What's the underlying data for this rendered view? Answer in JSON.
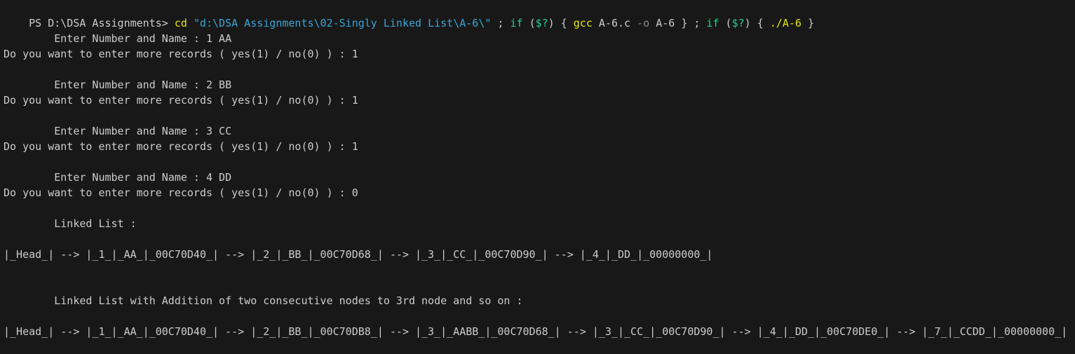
{
  "terminal": {
    "command_line": [
      {
        "text": "PS D:\\DSA Assignments> ",
        "color": "default"
      },
      {
        "text": "cd",
        "color": "yellow"
      },
      {
        "text": " ",
        "color": "default"
      },
      {
        "text": "\"d:\\DSA Assignments\\02-Singly Linked List\\A-6\\\"",
        "color": "cyan"
      },
      {
        "text": " ; ",
        "color": "default"
      },
      {
        "text": "if",
        "color": "green"
      },
      {
        "text": " (",
        "color": "default"
      },
      {
        "text": "$?",
        "color": "green"
      },
      {
        "text": ") { ",
        "color": "default"
      },
      {
        "text": "gcc",
        "color": "yellow"
      },
      {
        "text": " A-6.c ",
        "color": "default"
      },
      {
        "text": "-o",
        "color": "gray"
      },
      {
        "text": " A-6 } ; ",
        "color": "default"
      },
      {
        "text": "if",
        "color": "green"
      },
      {
        "text": " (",
        "color": "default"
      },
      {
        "text": "$?",
        "color": "green"
      },
      {
        "text": ") { ",
        "color": "default"
      },
      {
        "text": "./A-6",
        "color": "yellow"
      },
      {
        "text": " }",
        "color": "default"
      }
    ],
    "output_lines": [
      "",
      "        Enter Number and Name : 1 AA",
      "Do you want to enter more records ( yes(1) / no(0) ) : 1",
      "",
      "        Enter Number and Name : 2 BB",
      "Do you want to enter more records ( yes(1) / no(0) ) : 1",
      "",
      "        Enter Number and Name : 3 CC",
      "Do you want to enter more records ( yes(1) / no(0) ) : 1",
      "",
      "        Enter Number and Name : 4 DD",
      "Do you want to enter more records ( yes(1) / no(0) ) : 0",
      "",
      "        Linked List :",
      "",
      "|_Head_| --> |_1_|_AA_|_00C70D40_| --> |_2_|_BB_|_00C70D68_| --> |_3_|_CC_|_00C70D90_| --> |_4_|_DD_|_00000000_|",
      "",
      "",
      "        Linked List with Addition of two consecutive nodes to 3rd node and so on :",
      "",
      "|_Head_| --> |_1_|_AA_|_00C70D40_| --> |_2_|_BB_|_00C70DB8_| --> |_3_|_AABB_|_00C70D68_| --> |_3_|_CC_|_00C70D90_| --> |_4_|_DD_|_00C70DE0_| --> |_7_|_CCDD_|_00000000_|"
    ]
  },
  "colors": {
    "background": "#181818",
    "foreground": "#cccccc",
    "yellow": "#e5e510",
    "cyan": "#3ba4d6",
    "green": "#23d18b",
    "gray": "#8a8a8a"
  }
}
